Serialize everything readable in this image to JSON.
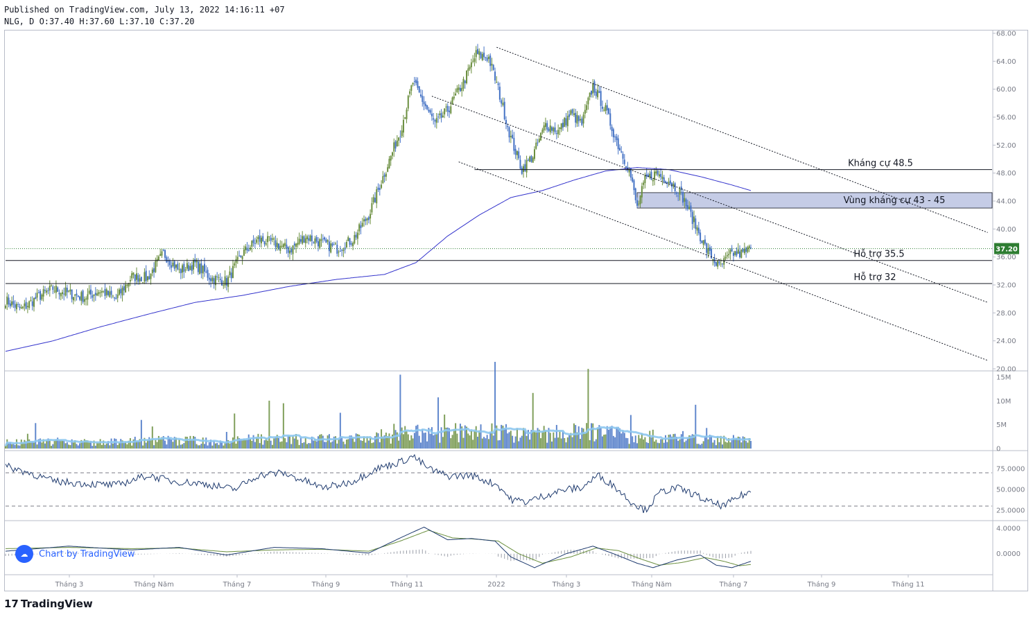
{
  "header": {
    "published": "Published on TradingView.com, July 13, 2022 14:16:11 +07",
    "ohlc": "NLG, D O:37.40 H:37.60 L:37.10 C:37.20"
  },
  "footer": {
    "logo_mark": "17",
    "logo_text": "TradingView"
  },
  "watermark": {
    "icon": "tradingview-cloud-icon",
    "text": "Chart by TradingView"
  },
  "colors": {
    "up": "#6a8e3e",
    "down": "#4472c4",
    "ma": "#3333cc",
    "vol_ma": "#8ec8f0",
    "last_price_bg": "#2e7d32",
    "zone": "#c5cce6",
    "rsi": "#1e3a6e"
  },
  "chart_data": [
    {
      "type": "candlestick",
      "symbol": "NLG",
      "timeframe": "D",
      "x_tick_labels": [
        "Tháng 3",
        "Tháng Năm",
        "Tháng 7",
        "Tháng 9",
        "Tháng 11",
        "2022",
        "Tháng 3",
        "Tháng Năm",
        "Tháng 7",
        "Tháng 9",
        "Tháng 11"
      ],
      "y_tick_labels": [
        "20.00",
        "24.00",
        "28.00",
        "32.00",
        "36.00",
        "40.00",
        "44.00",
        "48.00",
        "52.00",
        "56.00",
        "60.00",
        "64.00",
        "68.00"
      ],
      "ylim": [
        20,
        68
      ],
      "last_price": "37.20",
      "close_anchors": [
        [
          0,
          29.8
        ],
        [
          10,
          28.5
        ],
        [
          20,
          30.2
        ],
        [
          30,
          31.5
        ],
        [
          40,
          30.8
        ],
        [
          50,
          30.2
        ],
        [
          60,
          31.2
        ],
        [
          70,
          30.0
        ],
        [
          80,
          33.2
        ],
        [
          90,
          33.0
        ],
        [
          100,
          36.5
        ],
        [
          110,
          34.0
        ],
        [
          120,
          35.0
        ],
        [
          130,
          33.0
        ],
        [
          140,
          32.5
        ],
        [
          150,
          36.5
        ],
        [
          160,
          38.5
        ],
        [
          170,
          38.0
        ],
        [
          180,
          37.0
        ],
        [
          190,
          39.0
        ],
        [
          200,
          38.0
        ],
        [
          210,
          37.2
        ],
        [
          220,
          38.5
        ],
        [
          230,
          42.0
        ],
        [
          240,
          48.0
        ],
        [
          250,
          54.0
        ],
        [
          258,
          61.0
        ],
        [
          265,
          58.0
        ],
        [
          272,
          55.0
        ],
        [
          280,
          57.0
        ],
        [
          290,
          61.0
        ],
        [
          298,
          65.0
        ],
        [
          306,
          64.5
        ],
        [
          312,
          60.0
        ],
        [
          320,
          53.0
        ],
        [
          327,
          48.5
        ],
        [
          334,
          50.5
        ],
        [
          342,
          55.0
        ],
        [
          350,
          54.0
        ],
        [
          358,
          56.5
        ],
        [
          365,
          55.0
        ],
        [
          372,
          60.5
        ],
        [
          380,
          57.0
        ],
        [
          388,
          52.0
        ],
        [
          395,
          48.5
        ],
        [
          400,
          43.0
        ],
        [
          405,
          47.0
        ],
        [
          412,
          48.0
        ],
        [
          420,
          47.0
        ],
        [
          428,
          45.0
        ],
        [
          436,
          41.0
        ],
        [
          444,
          37.0
        ],
        [
          452,
          34.5
        ],
        [
          460,
          36.5
        ],
        [
          467,
          36.5
        ],
        [
          472,
          37.2
        ]
      ],
      "moving_average_anchors": [
        [
          0,
          22.5
        ],
        [
          30,
          24.0
        ],
        [
          60,
          26.0
        ],
        [
          90,
          27.8
        ],
        [
          120,
          29.5
        ],
        [
          150,
          30.5
        ],
        [
          180,
          31.8
        ],
        [
          210,
          32.8
        ],
        [
          240,
          33.5
        ],
        [
          260,
          35.2
        ],
        [
          280,
          39.0
        ],
        [
          300,
          42.0
        ],
        [
          320,
          44.5
        ],
        [
          340,
          45.5
        ],
        [
          360,
          47.0
        ],
        [
          380,
          48.3
        ],
        [
          400,
          48.8
        ],
        [
          420,
          48.5
        ],
        [
          440,
          47.5
        ],
        [
          460,
          46.3
        ],
        [
          472,
          45.5
        ]
      ],
      "trendlines": [
        {
          "from": [
            311,
            66.0
          ],
          "to": [
            622,
            39.5
          ]
        },
        {
          "from": [
            270,
            59.0
          ],
          "to": [
            622,
            29.5
          ]
        },
        {
          "from": [
            287,
            49.6
          ],
          "to": [
            622,
            21.2
          ]
        }
      ],
      "horizontal_levels": [
        {
          "value": 48.5,
          "label": "Kháng cự 48.5"
        },
        {
          "value": 35.5,
          "label": "Hỗ trợ 35.5"
        },
        {
          "value": 32.2,
          "label": "Hỗ trợ 32"
        }
      ],
      "zones": [
        {
          "from": 43.0,
          "to": 45.2,
          "label": "Vùng kháng cự 43 - 45"
        }
      ]
    },
    {
      "type": "bar",
      "name": "volume",
      "y_tick_labels": [
        "0",
        "5M",
        "10M",
        "15M"
      ],
      "ylim": [
        0,
        16000000
      ]
    },
    {
      "type": "line",
      "name": "RSI",
      "y_tick_labels": [
        "25.0000",
        "50.0000",
        "75.0000"
      ],
      "ylim": [
        15,
        95
      ],
      "reference_levels": [
        30,
        70
      ],
      "anchors": [
        [
          0,
          78
        ],
        [
          15,
          70
        ],
        [
          30,
          60
        ],
        [
          50,
          57
        ],
        [
          70,
          55
        ],
        [
          90,
          67
        ],
        [
          105,
          60
        ],
        [
          125,
          57
        ],
        [
          145,
          50
        ],
        [
          160,
          67
        ],
        [
          175,
          70
        ],
        [
          190,
          60
        ],
        [
          200,
          52
        ],
        [
          210,
          55
        ],
        [
          220,
          60
        ],
        [
          235,
          75
        ],
        [
          250,
          83
        ],
        [
          258,
          90
        ],
        [
          268,
          75
        ],
        [
          280,
          66
        ],
        [
          295,
          67
        ],
        [
          312,
          55
        ],
        [
          320,
          38
        ],
        [
          330,
          35
        ],
        [
          345,
          45
        ],
        [
          355,
          50
        ],
        [
          365,
          52
        ],
        [
          375,
          67
        ],
        [
          385,
          55
        ],
        [
          395,
          37
        ],
        [
          405,
          25
        ],
        [
          415,
          47
        ],
        [
          425,
          52
        ],
        [
          435,
          45
        ],
        [
          445,
          35
        ],
        [
          455,
          30
        ],
        [
          465,
          42
        ],
        [
          472,
          47
        ]
      ]
    },
    {
      "type": "line",
      "name": "MACD",
      "y_tick_labels": [
        "0.0000",
        "4.0000"
      ],
      "ylim": [
        -3.2,
        5.0
      ],
      "macd_anchors": [
        [
          0,
          0.4
        ],
        [
          40,
          1.2
        ],
        [
          80,
          0.6
        ],
        [
          110,
          1.0
        ],
        [
          140,
          -0.2
        ],
        [
          170,
          1.0
        ],
        [
          200,
          0.8
        ],
        [
          230,
          0.1
        ],
        [
          250,
          2.5
        ],
        [
          265,
          4.2
        ],
        [
          280,
          2.2
        ],
        [
          295,
          2.4
        ],
        [
          310,
          2.0
        ],
        [
          320,
          -0.5
        ],
        [
          335,
          -2.2
        ],
        [
          355,
          0.0
        ],
        [
          372,
          1.2
        ],
        [
          385,
          0.0
        ],
        [
          400,
          -1.5
        ],
        [
          410,
          -2.2
        ],
        [
          425,
          -1.0
        ],
        [
          440,
          -0.2
        ],
        [
          450,
          -1.8
        ],
        [
          460,
          -2.2
        ],
        [
          472,
          -1.2
        ]
      ],
      "signal_anchors": [
        [
          0,
          0.8
        ],
        [
          40,
          1.0
        ],
        [
          80,
          0.8
        ],
        [
          110,
          0.9
        ],
        [
          140,
          0.3
        ],
        [
          170,
          0.6
        ],
        [
          200,
          0.7
        ],
        [
          230,
          0.4
        ],
        [
          250,
          2.0
        ],
        [
          268,
          3.7
        ],
        [
          283,
          2.5
        ],
        [
          298,
          2.3
        ],
        [
          312,
          2.0
        ],
        [
          325,
          0.0
        ],
        [
          340,
          -1.5
        ],
        [
          358,
          -0.5
        ],
        [
          374,
          0.9
        ],
        [
          388,
          0.5
        ],
        [
          402,
          -0.8
        ],
        [
          414,
          -1.8
        ],
        [
          428,
          -1.4
        ],
        [
          443,
          -0.6
        ],
        [
          455,
          -1.2
        ],
        [
          465,
          -1.9
        ],
        [
          472,
          -1.7
        ]
      ]
    }
  ]
}
